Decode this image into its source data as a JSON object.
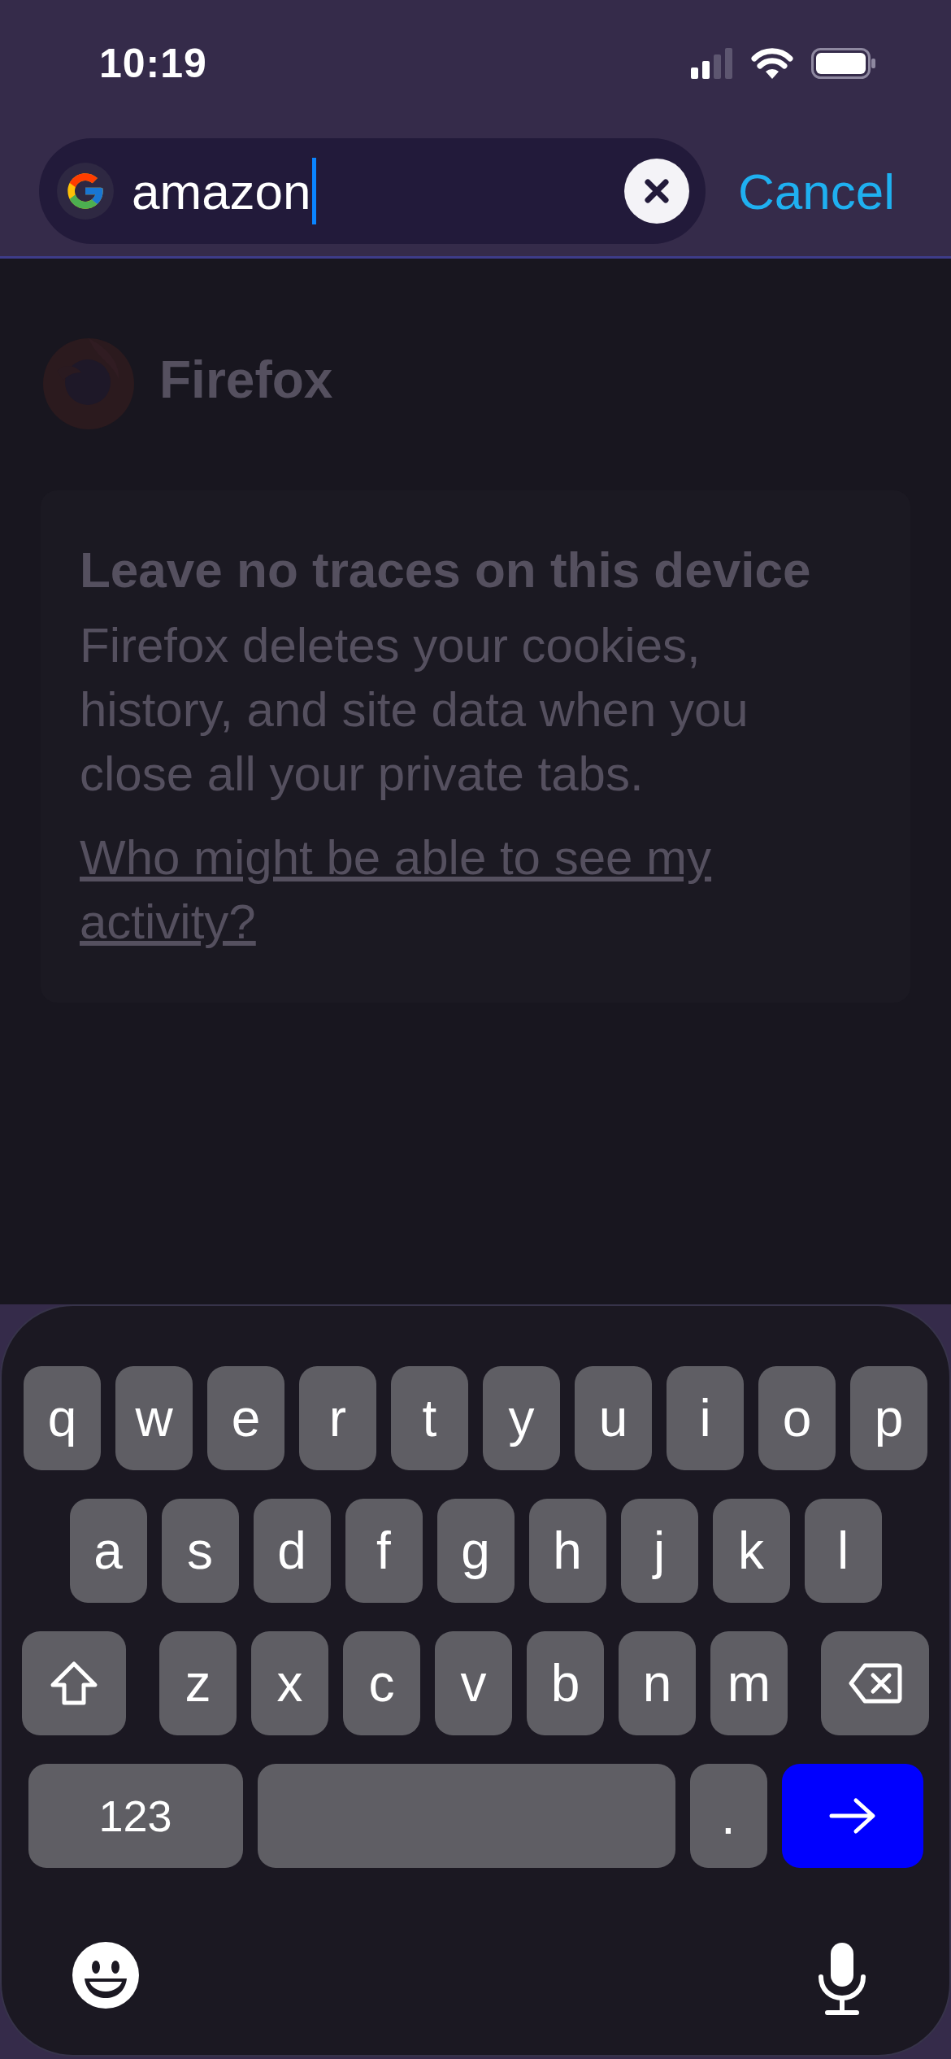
{
  "status_bar": {
    "time": "10:19"
  },
  "search_bar": {
    "value": "amazon",
    "cancel": "Cancel"
  },
  "private_home": {
    "logo_text": "Firefox",
    "heading": "Leave no traces on this device",
    "body": "Firefox deletes your cookies, history, and site data when you close all your private tabs.",
    "link": "Who might be able to see my activity?"
  },
  "keyboard": {
    "rows": [
      [
        {
          "kind": "char",
          "label": "q"
        },
        {
          "kind": "char",
          "label": "w"
        },
        {
          "kind": "char",
          "label": "e"
        },
        {
          "kind": "char",
          "label": "r"
        },
        {
          "kind": "char",
          "label": "t"
        },
        {
          "kind": "char",
          "label": "y"
        },
        {
          "kind": "char",
          "label": "u"
        },
        {
          "kind": "char",
          "label": "i"
        },
        {
          "kind": "char",
          "label": "o"
        },
        {
          "kind": "char",
          "label": "p"
        }
      ],
      [
        {
          "kind": "char",
          "label": "a"
        },
        {
          "kind": "char",
          "label": "s"
        },
        {
          "kind": "char",
          "label": "d"
        },
        {
          "kind": "char",
          "label": "f"
        },
        {
          "kind": "char",
          "label": "g"
        },
        {
          "kind": "char",
          "label": "h"
        },
        {
          "kind": "char",
          "label": "j"
        },
        {
          "kind": "char",
          "label": "k"
        },
        {
          "kind": "char",
          "label": "l"
        }
      ],
      [
        {
          "kind": "shift"
        },
        {
          "kind": "char",
          "label": "z"
        },
        {
          "kind": "char",
          "label": "x"
        },
        {
          "kind": "char",
          "label": "c"
        },
        {
          "kind": "char",
          "label": "v"
        },
        {
          "kind": "char",
          "label": "b"
        },
        {
          "kind": "char",
          "label": "n"
        },
        {
          "kind": "char",
          "label": "m"
        },
        {
          "kind": "delete"
        }
      ],
      [
        {
          "kind": "numbers",
          "label": "123"
        },
        {
          "kind": "space"
        },
        {
          "kind": "char",
          "label": "."
        },
        {
          "kind": "go"
        }
      ]
    ]
  }
}
